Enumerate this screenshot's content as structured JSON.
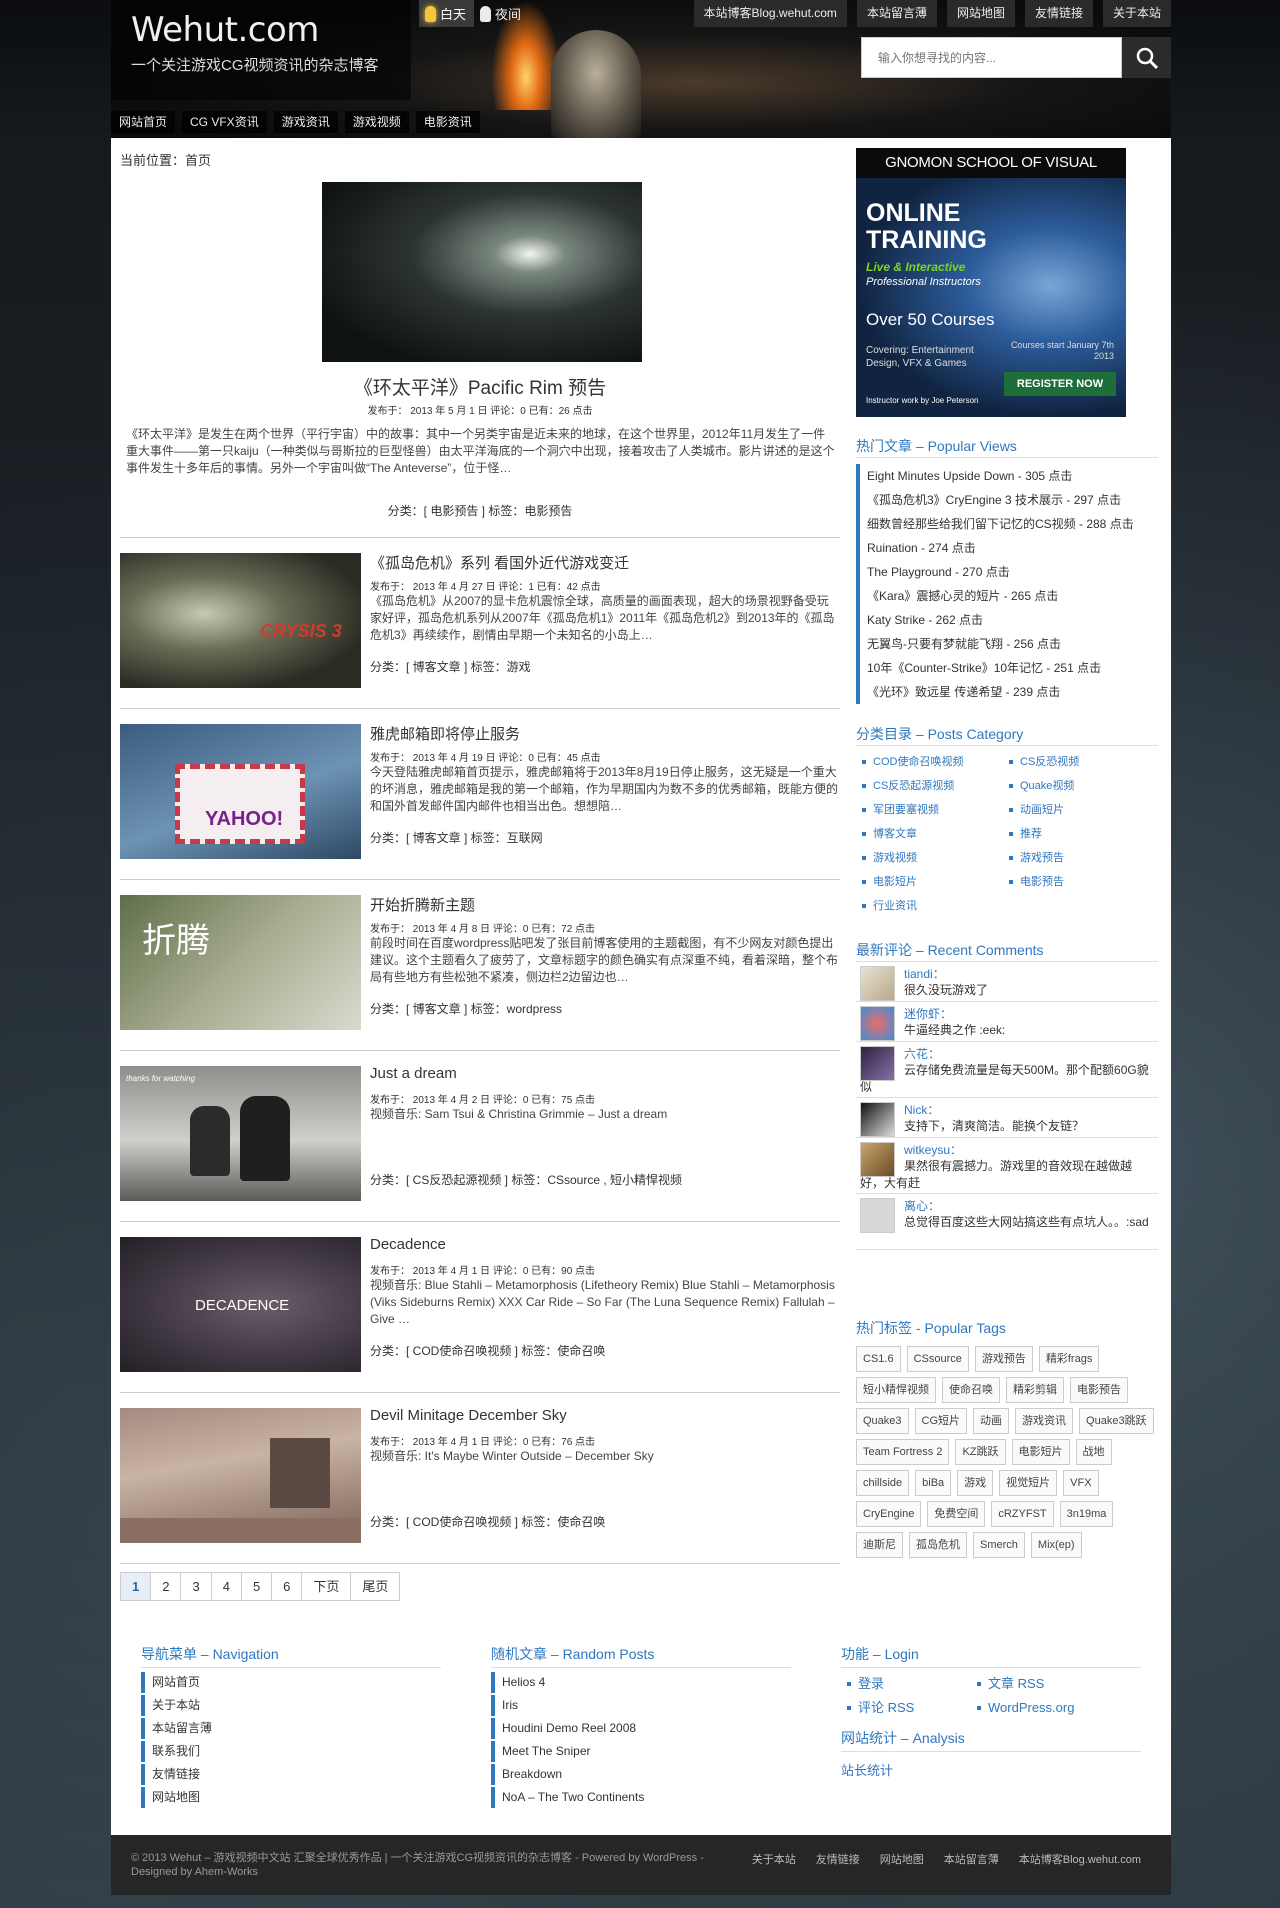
{
  "header": {
    "site_title": "Wehut.com",
    "tagline": "一个关注游戏CG视频资讯的杂志博客",
    "day_label": "白天",
    "night_label": "夜间",
    "top_nav": [
      "本站博客Blog.wehut.com",
      "本站留言薄",
      "网站地图",
      "友情链接",
      "关于本站"
    ],
    "search_placeholder": "输入你想寻找的内容...",
    "main_nav": [
      "网站首页",
      "CG VFX资讯",
      "游戏资讯",
      "游戏视频",
      "电影资讯"
    ]
  },
  "breadcrumb": "当前位置：首页",
  "featured": {
    "title": "《环太平洋》Pacific Rim 预告",
    "meta": "发布于： 2013 年 5 月 1 日  评论：0  已有：26 点击",
    "excerpt": "《环太平洋》是发生在两个世界（平行宇宙）中的故事：其中一个另类宇宙是近未来的地球，在这个世界里，2012年11月发生了一件重大事件——第一只kaiju（一种类似与哥斯拉的巨型怪兽）由太平洋海底的一个洞穴中出现，接着攻击了人类城市。影片讲述的是这个事件发生十多年后的事情。另外一个宇宙叫做“The Anteverse”，位于怪…",
    "cats": "分类：[ 电影预告 ]     标签：电影预告"
  },
  "posts": [
    {
      "title": "《孤岛危机》系列 看国外近代游戏变迁",
      "meta": "发布于： 2013 年 4 月 27 日  评论：1  已有：42 点击",
      "excerpt": "《孤岛危机》从2007的显卡危机震惊全球，高质量的画面表现，超大的场景视野备受玩家好评，孤岛危机系列从2007年《孤岛危机1》2011年《孤岛危机2》到2013年的《孤岛危机3》再续续作，剧情由早期一个未知名的小岛上…",
      "cats": "分类：[ 博客文章 ]    标签：游戏",
      "img": "CRYSIS 3"
    },
    {
      "title": "雅虎邮箱即将停止服务",
      "meta": "发布于： 2013 年 4 月 19 日  评论：0  已有：45 点击",
      "excerpt": "今天登陆雅虎邮箱首页提示，雅虎邮箱将于2013年8月19日停止服务，这无疑是一个重大的坏消息，雅虎邮箱是我的第一个邮箱，作为早期国内为数不多的优秀邮箱，既能方便的和国外首发邮件国内邮件也相当出色。想想陪…",
      "cats": "分类：[ 博客文章 ]    标签：互联网",
      "img": "YAHOO!"
    },
    {
      "title": "开始折腾新主题",
      "meta": "发布于： 2013 年 4 月 8 日  评论：0  已有：72 点击",
      "excerpt": "前段时间在百度wordpress贴吧发了张目前博客使用的主题截图，有不少网友对颜色提出建议。这个主题看久了疲劳了，文章标题字的颜色确实有点深重不纯，看着深暗，整个布局有些地方有些松弛不紧凑，侧边栏2边留边也…",
      "cats": "分类：[ 博客文章 ]    标签：wordpress",
      "img": "折腾"
    },
    {
      "title": "Just a dream",
      "meta": "发布于： 2013 年 4 月 2 日  评论：0  已有：75 点击",
      "excerpt": "视频音乐: Sam Tsui & Christina Grimmie – Just a dream",
      "cats": "分类：[ CS反恐起源视频 ]    标签：CSsource , 短小精悍视频",
      "img": "thanks for watching"
    },
    {
      "title": "Decadence",
      "meta": "发布于： 2013 年 4 月 1 日  评论：0  已有：90 点击",
      "excerpt": "视频音乐: Blue Stahli – Metamorphosis (Lifetheory Remix) Blue Stahli – Metamorphosis (Viks Sideburns Remix) XXX Car Ride – So Far (The Luna Sequence Remix) Fallulah – Give …",
      "cats": "分类：[ COD使命召唤视频 ]    标签：使命召唤",
      "img": "DECADENCE"
    },
    {
      "title": "Devil Minitage December Sky",
      "meta": "发布于： 2013 年 4 月 1 日  评论：0  已有：76 点击",
      "excerpt": "视频音乐: It's Maybe Winter Outside – December Sky",
      "cats": "分类：[ COD使命召唤视频 ]    标签：使命召唤",
      "img": ""
    }
  ],
  "pager": [
    "1",
    "2",
    "3",
    "4",
    "5",
    "6",
    "下页",
    "尾页"
  ],
  "sidebar": {
    "ad": {
      "header": "GNOMON SCHOOL OF VISUAL EFFECTS",
      "line1": "ONLINE",
      "line1b": "TRAINING",
      "line2": "Live & Interactive",
      "line3": "Professional Instructors",
      "line4": "Over 50 Courses",
      "line5": "Covering: Entertainment Design, VFX & Games",
      "line6": "Courses start January 7th 2013",
      "line7": "Instructor work by Joe Peterson",
      "button": "REGISTER NOW"
    },
    "popular_title": "热门文章 – Popular Views",
    "popular": [
      "Eight Minutes Upside Down - 305 点击",
      "《孤岛危机3》CryEngine 3 技术展示 - 297 点击",
      "细数曾经那些给我们留下记忆的CS视频 - 288 点击",
      "Ruination - 274 点击",
      "The Playground - 270 点击",
      "《Kara》震撼心灵的短片 - 265 点击",
      "Katy Strike - 262 点击",
      "无翼鸟-只要有梦就能飞翔 - 256 点击",
      "10年《Counter-Strike》10年记忆 - 251 点击",
      "《光环》致远星 传递希望 - 239 点击"
    ],
    "category_title": "分类目录 – Posts Category",
    "categories": [
      "COD使命召唤视频",
      "CS反恐视频",
      "CS反恐起源视频",
      "Quake视频",
      "军团要塞视频",
      "动画短片",
      "博客文章",
      "推荐",
      "游戏视频",
      "游戏预告",
      "电影短片",
      "电影预告",
      "行业资讯"
    ],
    "comments_title": "最新评论 – Recent Comments",
    "comments": [
      {
        "name": "tiandi：",
        "text": "很久没玩游戏了"
      },
      {
        "name": "迷你虾：",
        "text": "牛逼经典之作 :eek:"
      },
      {
        "name": "六花：",
        "text": "云存储免费流量是每天500M。那个配额60G貌似"
      },
      {
        "name": "Nick：",
        "text": "支持下，清爽简洁。能换个友链？"
      },
      {
        "name": "witkeysu：",
        "text": "果然很有震撼力。游戏里的音效现在越做越好，大有赶"
      },
      {
        "name": "离心：",
        "text": "总觉得百度这些大网站搞这些有点坑人。。:sad"
      }
    ],
    "tags_title": "热门标签 - Popular Tags",
    "tags": [
      "CS1.6",
      "CSsource",
      "游戏预告",
      "精彩frags",
      "短小精悍视频",
      "使命召唤",
      "精彩剪辑",
      "电影预告",
      "Quake3",
      "CG短片",
      "动画",
      "游戏资讯",
      "Quake3跳跃",
      "Team Fortress 2",
      "KZ跳跃",
      "电影短片",
      "战地",
      "chillside",
      "biBa",
      "游戏",
      "视觉短片",
      "VFX",
      "CryEngine",
      "免费空间",
      "cRZYFST",
      "3n19ma",
      "迪斯尼",
      "孤岛危机",
      "Smerch",
      "Mix(ep)"
    ]
  },
  "footer_widgets": {
    "nav_title": "导航菜单 – Navigation",
    "nav": [
      "网站首页",
      "关于本站",
      "本站留言薄",
      "联系我们",
      "友情链接",
      "网站地图"
    ],
    "random_title": "随机文章 – Random Posts",
    "random": [
      "Helios 4",
      "Iris",
      "Houdini Demo Reel 2008",
      "Meet The Sniper",
      "Breakdown",
      "NoA – The Two Continents"
    ],
    "login_title": "功能 – Login",
    "login": [
      "登录",
      "文章 RSS",
      "评论 RSS",
      "WordPress.org"
    ],
    "analysis_title": "网站统计 – Analysis",
    "analysis_link": "站长统计"
  },
  "footer": {
    "copyright": "© 2013   Wehut – 游戏视频中文站 汇聚全球优秀作品 | 一个关注游戏CG视频资讯的杂志博客 - Powered by WordPress - Designed by Ahem-Works",
    "links": [
      "关于本站",
      "友情链接",
      "网站地图",
      "本站留言薄",
      "本站博客Blog.wehut.com"
    ]
  }
}
